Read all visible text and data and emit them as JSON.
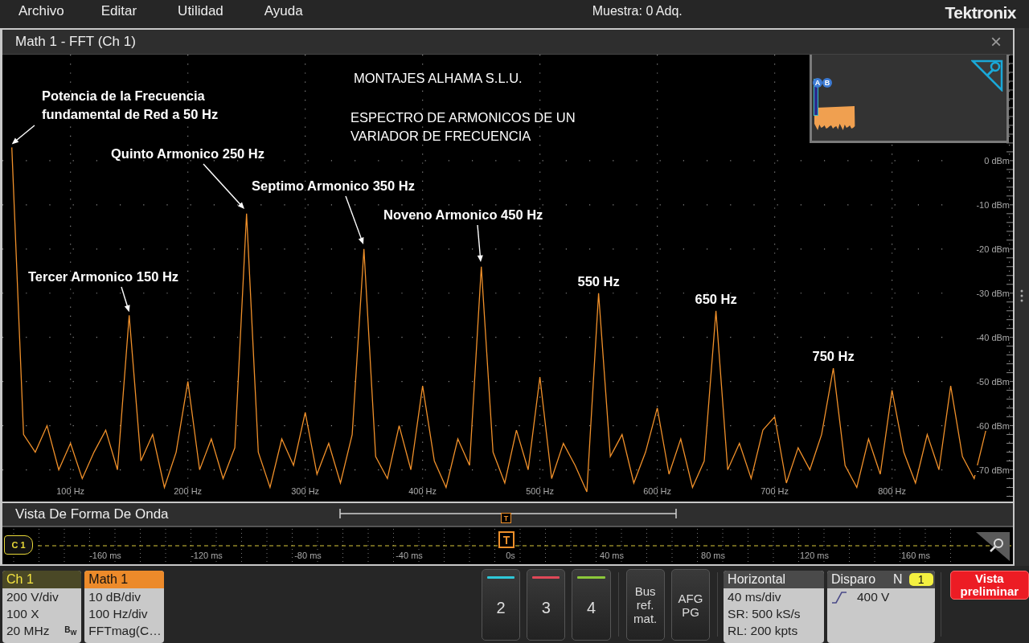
{
  "menu_bar": {
    "items": [
      "Archivo",
      "Editar",
      "Utilidad",
      "Ayuda"
    ],
    "status": "Muestra: 0 Adq.",
    "brand": "Tektronix"
  },
  "fft_window": {
    "title": "Math 1 - FFT (Ch 1)",
    "close": "×",
    "notes": [
      "MONTAJES ALHAMA S.L.U.",
      "ESPECTRO DE ARMONICOS DE UN VARIADOR DE FRECUENCIA"
    ],
    "overview": {
      "cursors": [
        "A",
        "B"
      ]
    },
    "chart_data": {
      "type": "line",
      "grid": true,
      "x": [
        50,
        60,
        70,
        80,
        90,
        100,
        110,
        120,
        130,
        140,
        150,
        160,
        170,
        180,
        190,
        200,
        210,
        220,
        230,
        240,
        250,
        260,
        270,
        280,
        290,
        300,
        310,
        320,
        330,
        340,
        350,
        360,
        370,
        380,
        390,
        400,
        410,
        420,
        430,
        440,
        450,
        460,
        470,
        480,
        490,
        500,
        510,
        520,
        530,
        540,
        550,
        560,
        570,
        580,
        590,
        600,
        610,
        620,
        630,
        640,
        650,
        660,
        670,
        680,
        690,
        700,
        710,
        720,
        730,
        740,
        750,
        760,
        770,
        780,
        790,
        800,
        810,
        820,
        830,
        840,
        850,
        860,
        870,
        880
      ],
      "series": [
        {
          "color": "#f0902a",
          "values": [
            3,
            -62,
            -66,
            -60,
            -70,
            -64,
            -72,
            -66,
            -61,
            -70,
            -35,
            -68,
            -62,
            -74,
            -66,
            -50,
            -70,
            -63,
            -72,
            -65,
            -12,
            -66,
            -74,
            -63,
            -69,
            -57,
            -71,
            -64,
            -73,
            -62,
            -20,
            -67,
            -72,
            -60,
            -70,
            -51,
            -68,
            -74,
            -63,
            -69,
            -24,
            -66,
            -73,
            -61,
            -70,
            -49,
            -72,
            -64,
            -69,
            -75,
            -30,
            -67,
            -62,
            -73,
            -66,
            -56,
            -71,
            -63,
            -74,
            -68,
            -34,
            -70,
            -64,
            -72,
            -61,
            -58,
            -73,
            -65,
            -70,
            -62,
            -47,
            -69,
            -74,
            -63,
            -71,
            -52,
            -66,
            -73,
            -62,
            -70,
            -51,
            -67,
            -72,
            -61
          ]
        }
      ],
      "xlim": [
        42,
        903
      ],
      "ylim": [
        -77,
        24
      ],
      "xticks": [
        {
          "value": 100,
          "label": "100 Hz"
        },
        {
          "value": 200,
          "label": "200 Hz"
        },
        {
          "value": 300,
          "label": "300 Hz"
        },
        {
          "value": 400,
          "label": "400 Hz"
        },
        {
          "value": 500,
          "label": "500 Hz"
        },
        {
          "value": 600,
          "label": "600 Hz"
        },
        {
          "value": 700,
          "label": "700 Hz"
        },
        {
          "value": 800,
          "label": "800 Hz"
        }
      ],
      "yticks": [
        {
          "value": 0,
          "label": "0 dBm"
        },
        {
          "value": -10,
          "label": "-10 dBm"
        },
        {
          "value": -20,
          "label": "-20 dBm"
        },
        {
          "value": -30,
          "label": "-30 dBm"
        },
        {
          "value": -40,
          "label": "-40 dBm"
        },
        {
          "value": -50,
          "label": "-50 dBm"
        },
        {
          "value": -60,
          "label": "-60 dBm"
        },
        {
          "value": -70,
          "label": "-70 dBm"
        }
      ],
      "annotations": [
        {
          "text": "Potencia de la Frecuencia fundamental de Red a 50 Hz",
          "x": 50,
          "y": 3
        },
        "Quinto Armonico 250 Hz",
        "Septimo Armonico 350 Hz",
        "Noveno Armonico 450 Hz",
        {
          "text": "Tercer Armonico 150 Hz",
          "x": 150,
          "y": -35
        },
        {
          "text": "550 Hz",
          "x": 550,
          "y": -30
        },
        {
          "text": "650 Hz",
          "x": 650,
          "y": -34
        },
        {
          "text": "750 Hz",
          "x": 750,
          "y": -47
        }
      ]
    }
  },
  "waveform_view": {
    "title": "Vista De Forma De Onda",
    "overview_marker": "T",
    "channel_tag": "C 1",
    "trigger_marker": "T",
    "time_labels": [
      "-160 ms",
      "-120 ms",
      "-80 ms",
      "-40 ms",
      "0s",
      "40 ms",
      "80 ms",
      "120 ms",
      "160 ms"
    ]
  },
  "channel_badges": [
    {
      "kind": "channel",
      "title": "Ch 1",
      "lines": [
        "200 V/div",
        "100 X",
        "20 MHz"
      ],
      "bw_mark": "B$_{W}$"
    },
    {
      "kind": "math",
      "title": "Math 1",
      "lines": [
        "10 dB/div",
        "100 Hz/div",
        "FFTmag(C…"
      ]
    }
  ],
  "channel_buttons": [
    {
      "label": "2",
      "color": "#2ec8d8"
    },
    {
      "label": "3",
      "color": "#e04858"
    },
    {
      "label": "4",
      "color": "#8cc83a"
    }
  ],
  "menu_buttons": [
    "Bus ref. mat.",
    "AFG PG"
  ],
  "horizontal": {
    "title": "Horizontal",
    "lines": [
      "40 ms/div",
      "SR: 500 kS/s",
      "RL: 200 kpts"
    ]
  },
  "trigger": {
    "title": "Disparo",
    "mode": "N",
    "count": "1",
    "level": "400 V"
  },
  "preview_button": "Vista preliminar"
}
